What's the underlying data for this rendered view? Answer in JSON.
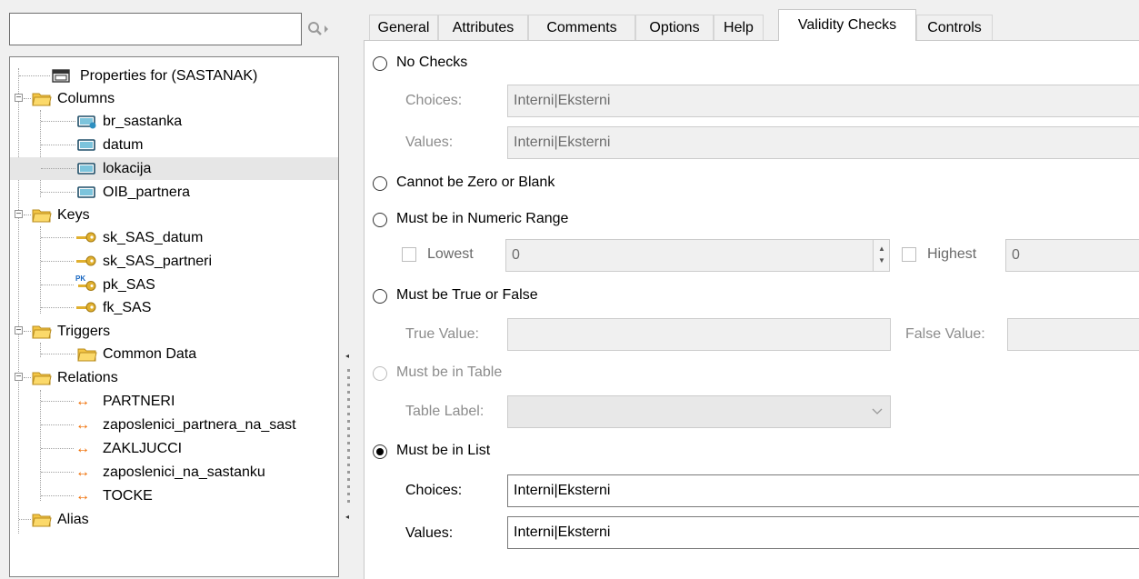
{
  "search": {
    "value": ""
  },
  "tree": {
    "root": "Properties for (SASTANAK)",
    "columns_label": "Columns",
    "columns": [
      "br_sastanka",
      "datum",
      "lokacija",
      "OIB_partnera"
    ],
    "keys_label": "Keys",
    "keys": [
      "sk_SAS_datum",
      "sk_SAS_partneri",
      "pk_SAS",
      "fk_SAS"
    ],
    "pk_badge": "PK",
    "triggers_label": "Triggers",
    "triggers": [
      "Common Data"
    ],
    "relations_label": "Relations",
    "relations": [
      "PARTNERI",
      "zaposlenici_partnera_na_sast",
      "ZAKLJUCCI",
      "zaposlenici_na_sastanku",
      "TOCKE"
    ],
    "alias_label": "Alias",
    "selected_item": "lokacija"
  },
  "tabs": [
    "General",
    "Attributes",
    "Comments",
    "Options",
    "Help",
    "Validity Checks",
    "Controls"
  ],
  "active_tab": "Validity Checks",
  "validity": {
    "no_checks": {
      "label": "No Checks",
      "choices_label": "Choices:",
      "choices_value": "Interni|Eksterni",
      "values_label": "Values:",
      "values_value": "Interni|Eksterni"
    },
    "not_zero": {
      "label": "Cannot be Zero or Blank"
    },
    "numeric_range": {
      "label": "Must be in Numeric Range",
      "lowest_label": "Lowest",
      "lowest_value": "0",
      "highest_label": "Highest",
      "highest_value": "0"
    },
    "true_false": {
      "label": "Must be True or False",
      "true_label": "True Value:",
      "true_value": "",
      "false_label": "False Value:",
      "false_value": ""
    },
    "in_table": {
      "label": "Must be in Table",
      "table_label": "Table Label:",
      "table_value": ""
    },
    "in_list": {
      "label": "Must be in List",
      "choices_label": "Choices:",
      "choices_value": "Interni|Eksterni",
      "values_label": "Values:",
      "values_value": "Interni|Eksterni"
    },
    "selected_option": "Must be in List"
  },
  "colors": {
    "folder": "#f3c544",
    "relation": "#ef6c00",
    "key": "#e0b030",
    "column_icon": "#1f6f8b"
  },
  "icons": [
    "search-icon",
    "folder-icon",
    "column-icon",
    "key-icon",
    "primary-key-icon",
    "relation-icon",
    "table-icon",
    "spin-up-icon",
    "spin-down-icon",
    "dropdown-chevron-icon"
  ]
}
